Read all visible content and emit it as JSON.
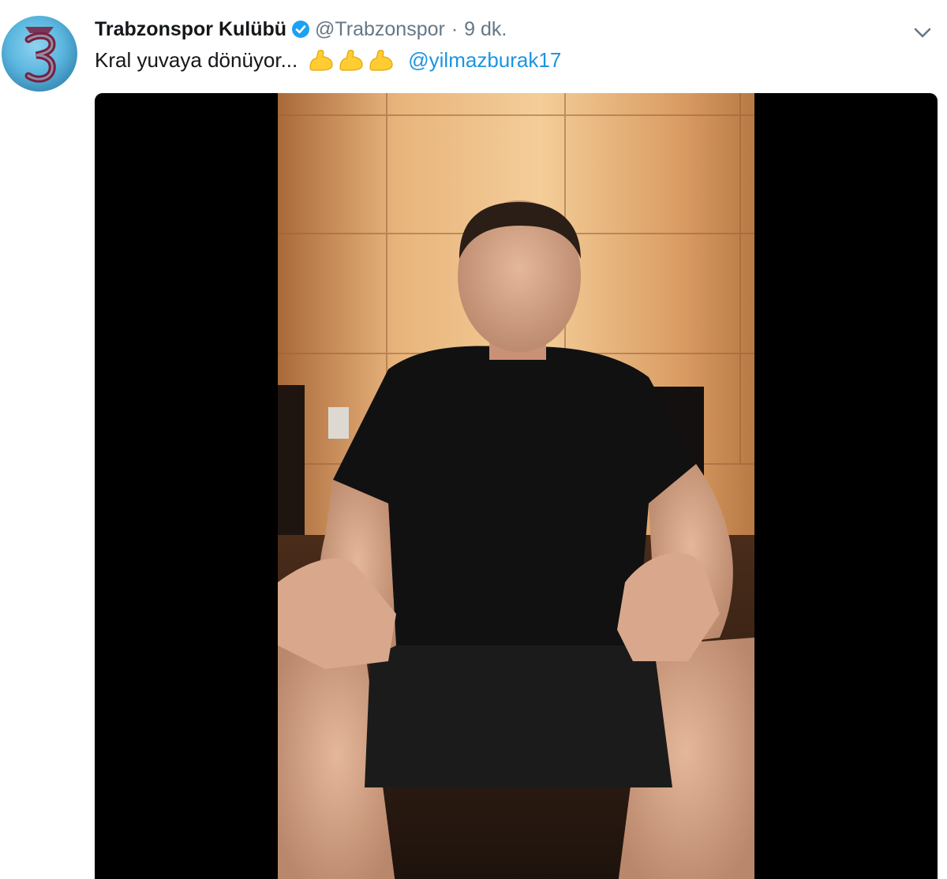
{
  "tweet": {
    "display_name": "Trabzonspor Kulübü",
    "handle": "@Trabzonspor",
    "separator": "·",
    "timestamp": "9 dk.",
    "text": "Kral yuvaya dönüyor...",
    "emojis": [
      "flexed-biceps",
      "flexed-biceps",
      "flexed-biceps"
    ],
    "mention": "@yilmazburak17"
  },
  "icons": {
    "verified": "verified-badge-icon",
    "menu": "chevron-down-icon",
    "avatar": "club-logo"
  },
  "colors": {
    "name": "#14171a",
    "secondary": "#657786",
    "link": "#1b95e0",
    "verified": "#1da1f2",
    "media_background": "#000000",
    "emoji": "#ffcc33"
  },
  "media": {
    "type": "video"
  }
}
